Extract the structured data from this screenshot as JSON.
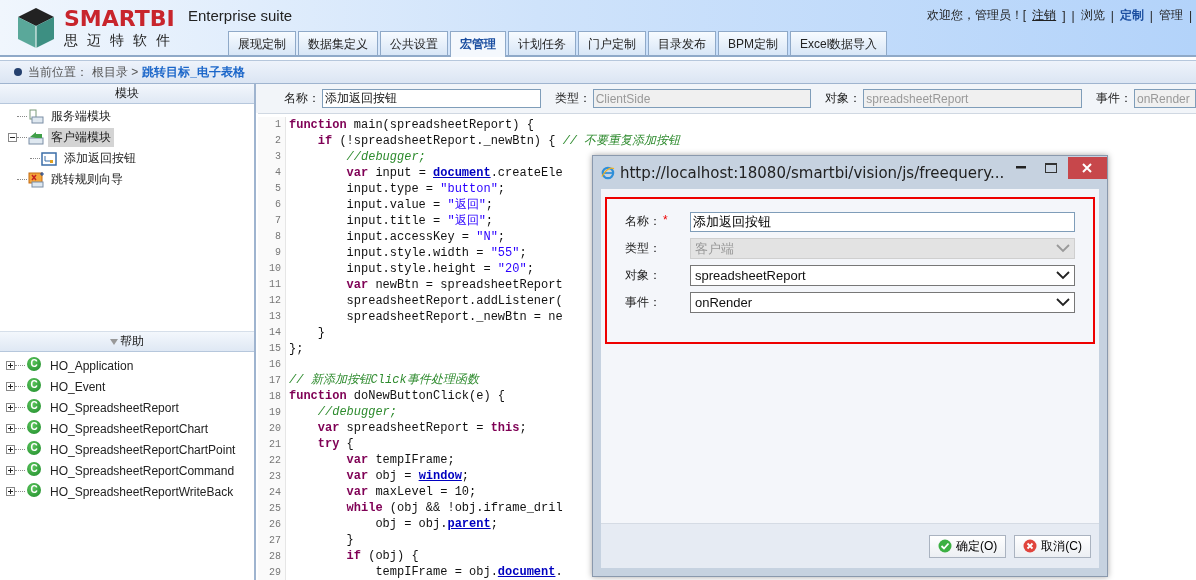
{
  "header": {
    "brand": "SMARTBI",
    "brand_sub": "思迈特软件",
    "product": "Enterprise suite",
    "welcome": "欢迎您，管理员！",
    "logout": {
      "open": "[",
      "label": "注销",
      "close": "]"
    },
    "separator": "|",
    "nav": [
      {
        "label": "浏览",
        "selected": false
      },
      {
        "label": "定制",
        "selected": true
      },
      {
        "label": "管理",
        "selected": false
      }
    ],
    "tabs": [
      {
        "label": "展现定制",
        "selected": false
      },
      {
        "label": "数据集定义",
        "selected": false
      },
      {
        "label": "公共设置",
        "selected": false
      },
      {
        "label": "宏管理",
        "selected": true
      },
      {
        "label": "计划任务",
        "selected": false
      },
      {
        "label": "门户定制",
        "selected": false
      },
      {
        "label": "目录发布",
        "selected": false
      },
      {
        "label": "BPM定制",
        "selected": false
      },
      {
        "label": "Excel数据导入",
        "selected": false
      }
    ]
  },
  "breadcrumb": {
    "label": "当前位置：",
    "root": "根目录 >",
    "current": "跳转目标_电子表格"
  },
  "modules": {
    "title": "模块",
    "items": [
      {
        "label": "服务端模块",
        "kind": "server",
        "selected": false
      },
      {
        "label": "客户端模块",
        "kind": "client",
        "selected": true,
        "expanded": true,
        "children": [
          {
            "label": "添加返回按钮",
            "kind": "macro",
            "selected": false
          }
        ]
      },
      {
        "label": "跳转规则向导",
        "kind": "wizard",
        "selected": false
      }
    ]
  },
  "help": {
    "title": "帮助",
    "items": [
      {
        "label": "HO_Application",
        "icon_letter": "C",
        "expanded": false
      },
      {
        "label": "HO_Event",
        "icon_letter": "C",
        "expanded": false
      },
      {
        "label": "HO_SpreadsheetReport",
        "icon_letter": "C",
        "expanded": false
      },
      {
        "label": "HO_SpreadsheetReportChart",
        "icon_letter": "C",
        "expanded": false
      },
      {
        "label": "HO_SpreadsheetReportChartPoint",
        "icon_letter": "C",
        "expanded": false
      },
      {
        "label": "HO_SpreadsheetReportCommand",
        "icon_letter": "C",
        "expanded": false
      },
      {
        "label": "HO_SpreadsheetReportWriteBack",
        "icon_letter": "C",
        "expanded": false
      }
    ]
  },
  "fields": [
    {
      "label": "名称：",
      "value": "添加返回按钮",
      "disabled": false
    },
    {
      "label": "类型：",
      "value": "ClientSide",
      "disabled": true
    },
    {
      "label": "对象：",
      "value": "spreadsheetReport",
      "disabled": true
    },
    {
      "label": "事件：",
      "value": "onRender",
      "disabled": true
    }
  ],
  "code": [
    {
      "number": "1",
      "tokens": [
        {
          "kind": "kw",
          "text": "function"
        },
        {
          "kind": "plain",
          "text": " main(spreadsheetReport) {"
        }
      ]
    },
    {
      "number": "2",
      "tokens": [
        {
          "kind": "kw",
          "text": "    if"
        },
        {
          "kind": "plain",
          "text": " (!spreadsheetReport._newBtn) { "
        },
        {
          "kind": "com",
          "text": "// 不要重复添加按钮"
        }
      ]
    },
    {
      "number": "3",
      "tokens": [
        {
          "kind": "com",
          "text": "        //debugger;"
        }
      ]
    },
    {
      "number": "4",
      "tokens": [
        {
          "kind": "kw",
          "text": "        var"
        },
        {
          "kind": "plain",
          "text": " input = "
        },
        {
          "kind": "obj",
          "text": "document"
        },
        {
          "kind": "plain",
          "text": ".createEle"
        }
      ]
    },
    {
      "number": "5",
      "tokens": [
        {
          "kind": "plain",
          "text": "        input.type = "
        },
        {
          "kind": "str",
          "text": "\"button\""
        },
        {
          "kind": "plain",
          "text": ";"
        }
      ]
    },
    {
      "number": "6",
      "tokens": [
        {
          "kind": "plain",
          "text": "        input.value = "
        },
        {
          "kind": "str",
          "text": "\"返回\""
        },
        {
          "kind": "plain",
          "text": ";"
        }
      ]
    },
    {
      "number": "7",
      "tokens": [
        {
          "kind": "plain",
          "text": "        input.title = "
        },
        {
          "kind": "str",
          "text": "\"返回\""
        },
        {
          "kind": "plain",
          "text": ";"
        }
      ]
    },
    {
      "number": "8",
      "tokens": [
        {
          "kind": "plain",
          "text": "        input.accessKey = "
        },
        {
          "kind": "str",
          "text": "\"N\""
        },
        {
          "kind": "plain",
          "text": ";"
        }
      ]
    },
    {
      "number": "9",
      "tokens": [
        {
          "kind": "plain",
          "text": "        input.style.width = "
        },
        {
          "kind": "str",
          "text": "\"55\""
        },
        {
          "kind": "plain",
          "text": ";"
        }
      ]
    },
    {
      "number": "10",
      "tokens": [
        {
          "kind": "plain",
          "text": "        input.style.height = "
        },
        {
          "kind": "str",
          "text": "\"20\""
        },
        {
          "kind": "plain",
          "text": ";"
        }
      ]
    },
    {
      "number": "11",
      "tokens": [
        {
          "kind": "kw",
          "text": "        var"
        },
        {
          "kind": "plain",
          "text": " newBtn = spreadsheetReport"
        }
      ]
    },
    {
      "number": "12",
      "tokens": [
        {
          "kind": "plain",
          "text": "        spreadsheetReport.addListener("
        }
      ]
    },
    {
      "number": "13",
      "tokens": [
        {
          "kind": "plain",
          "text": "        spreadsheetReport._newBtn = ne"
        }
      ]
    },
    {
      "number": "14",
      "tokens": [
        {
          "kind": "plain",
          "text": "    }"
        }
      ]
    },
    {
      "number": "15",
      "tokens": [
        {
          "kind": "plain",
          "text": "};"
        }
      ]
    },
    {
      "number": "16"
    },
    {
      "number": "17",
      "tokens": [
        {
          "kind": "com",
          "text": "// 新添加按钮Click事件处理函数"
        }
      ]
    },
    {
      "number": "18",
      "tokens": [
        {
          "kind": "kw",
          "text": "function"
        },
        {
          "kind": "plain",
          "text": " doNewButtonClick(e) {"
        }
      ]
    },
    {
      "number": "19",
      "tokens": [
        {
          "kind": "com",
          "text": "    //debugger;"
        }
      ]
    },
    {
      "number": "20",
      "tokens": [
        {
          "kind": "kw",
          "text": "    var"
        },
        {
          "kind": "plain",
          "text": " spreadsheetReport = "
        },
        {
          "kind": "kw",
          "text": "this"
        },
        {
          "kind": "plain",
          "text": ";"
        }
      ]
    },
    {
      "number": "21",
      "tokens": [
        {
          "kind": "kw",
          "text": "    try"
        },
        {
          "kind": "plain",
          "text": " {"
        }
      ]
    },
    {
      "number": "22",
      "tokens": [
        {
          "kind": "kw",
          "text": "        var"
        },
        {
          "kind": "plain",
          "text": " tempIFrame;"
        }
      ]
    },
    {
      "number": "23",
      "tokens": [
        {
          "kind": "kw",
          "text": "        var"
        },
        {
          "kind": "plain",
          "text": " obj = "
        },
        {
          "kind": "obj",
          "text": "window"
        },
        {
          "kind": "plain",
          "text": ";"
        }
      ]
    },
    {
      "number": "24",
      "tokens": [
        {
          "kind": "kw",
          "text": "        var"
        },
        {
          "kind": "plain",
          "text": " maxLevel = 10;"
        }
      ]
    },
    {
      "number": "25",
      "tokens": [
        {
          "kind": "kw",
          "text": "        while"
        },
        {
          "kind": "plain",
          "text": " (obj && !obj.iframe_dril"
        }
      ]
    },
    {
      "number": "26",
      "tokens": [
        {
          "kind": "plain",
          "text": "            obj = obj."
        },
        {
          "kind": "obj",
          "text": "parent"
        },
        {
          "kind": "plain",
          "text": ";"
        }
      ]
    },
    {
      "number": "27",
      "tokens": [
        {
          "kind": "plain",
          "text": "        }"
        }
      ]
    },
    {
      "number": "28",
      "tokens": [
        {
          "kind": "kw",
          "text": "        if"
        },
        {
          "kind": "plain",
          "text": " (obj) {"
        }
      ]
    },
    {
      "number": "29",
      "tokens": [
        {
          "kind": "plain",
          "text": "            tempIFrame = obj."
        },
        {
          "kind": "obj",
          "text": "document"
        },
        {
          "kind": "plain",
          "text": "."
        }
      ]
    }
  ],
  "dialog": {
    "title": "http://localhost:18080/smartbi/vision/js/freequery...",
    "fields": [
      {
        "label": "名称：",
        "required_mark": "*",
        "value": "添加返回按钮",
        "kind": "text",
        "disabled": false
      },
      {
        "label": "类型：",
        "value": "客户端",
        "kind": "select",
        "disabled": true
      },
      {
        "label": "对象：",
        "value": "spreadsheetReport",
        "kind": "select",
        "disabled": false
      },
      {
        "label": "事件：",
        "value": "onRender",
        "kind": "select",
        "disabled": false
      }
    ],
    "buttons": [
      {
        "label": "确定(O)",
        "kind": "ok"
      },
      {
        "label": "取消(C)",
        "kind": "cancel"
      }
    ]
  }
}
